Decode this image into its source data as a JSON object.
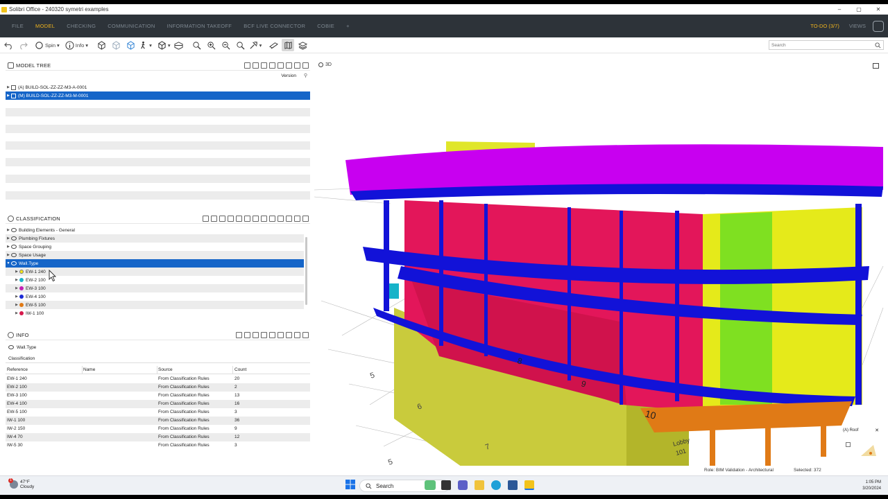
{
  "window": {
    "title": "Solibri Office - 240320 symetri examples",
    "controls": [
      "–",
      "▢",
      "✕"
    ]
  },
  "menu": {
    "items": [
      "FILE",
      "MODEL",
      "CHECKING",
      "COMMUNICATION",
      "INFORMATION TAKEOFF",
      "BCF LIVE CONNECTOR",
      "COBIE",
      "+"
    ],
    "active": "MODEL",
    "todo": "TO-DO (3/7)",
    "views": "VIEWS"
  },
  "toolbar": {
    "spin_label": "Spin",
    "info_label": "Info",
    "search_placeholder": "Search"
  },
  "model_tree": {
    "title": "MODEL TREE",
    "version_label": "Version",
    "items": [
      {
        "label": "(A) BUILD-SOL-ZZ-ZZ-M3-A-0001",
        "selected": false
      },
      {
        "label": "(M) BUILD-SOL-ZZ-ZZ-M3-M-0001",
        "selected": true
      }
    ]
  },
  "classification": {
    "title": "CLASSIFICATION",
    "items": [
      {
        "label": "Building Elements - General",
        "level": 0
      },
      {
        "label": "Plumbing Fixtures",
        "level": 0
      },
      {
        "label": "Space Grouping",
        "level": 0
      },
      {
        "label": "Space Usage",
        "level": 0
      },
      {
        "label": "Wall.Type",
        "level": 0,
        "selected": true
      },
      {
        "label": "EW-1 240",
        "level": 1,
        "color": "#f5e61c"
      },
      {
        "label": "EW-2 100",
        "level": 1,
        "color": "#17b3c9"
      },
      {
        "label": "EW-3 100",
        "level": 1,
        "color": "#c21fb6"
      },
      {
        "label": "EW-4 100",
        "level": 1,
        "color": "#1c2bd6"
      },
      {
        "label": "EW-5 100",
        "level": 1,
        "color": "#e07a16"
      },
      {
        "label": "IW-1 100",
        "level": 1,
        "color": "#d61a4c"
      }
    ]
  },
  "info": {
    "title": "INFO",
    "subject": "Wall.Type",
    "tab": "Classification",
    "columns": [
      "Reference",
      "Name",
      "Source",
      "Count"
    ],
    "rows": [
      {
        "ref": "EW-1 240",
        "name": "",
        "source": "From Classification Rules",
        "count": "20"
      },
      {
        "ref": "EW-2 100",
        "name": "",
        "source": "From Classification Rules",
        "count": "2"
      },
      {
        "ref": "EW-3 100",
        "name": "",
        "source": "From Classification Rules",
        "count": "13"
      },
      {
        "ref": "EW-4 100",
        "name": "",
        "source": "From Classification Rules",
        "count": "16"
      },
      {
        "ref": "EW-5 100",
        "name": "",
        "source": "From Classification Rules",
        "count": "3"
      },
      {
        "ref": "IW-1 100",
        "name": "",
        "source": "From Classification Rules",
        "count": "36"
      },
      {
        "ref": "IW-2 150",
        "name": "",
        "source": "From Classification Rules",
        "count": "9"
      },
      {
        "ref": "IW-4 70",
        "name": "",
        "source": "From Classification Rules",
        "count": "12"
      },
      {
        "ref": "IW-5 30",
        "name": "",
        "source": "From Classification Rules",
        "count": "3"
      }
    ]
  },
  "view": {
    "label": "3D",
    "grid_labels": [
      "5",
      "6",
      "7",
      "5",
      "8",
      "9",
      "10"
    ],
    "room_label": "Lobby",
    "room_number": "101",
    "minimap_label": "(A) Roof"
  },
  "status": {
    "role": "Role: BIM Validation - Architectural",
    "selected": "Selected: 372"
  },
  "taskbar": {
    "weather_temp": "47°F",
    "weather_desc": "Cloudy",
    "notification_count": "1",
    "search_label": "Search",
    "time": "1:05 PM",
    "date": "3/20/2024"
  },
  "colors": {
    "roof": "#c800f0",
    "structure": "#1212d8",
    "wall_red": "#e3165a",
    "wall_yellow": "#e5ea1a",
    "wall_green": "#7fe021",
    "base_yellow": "#c9cb3c",
    "orange": "#e07a16",
    "accent": "#f0b41e",
    "selection": "#1565c8"
  }
}
